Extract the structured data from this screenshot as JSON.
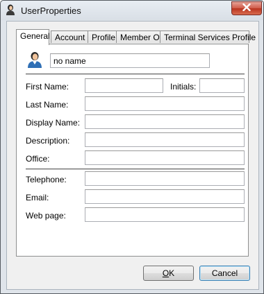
{
  "window": {
    "title": "UserProperties"
  },
  "icons": {
    "app": "user-icon",
    "close": "close-icon",
    "user": "user-icon"
  },
  "tabs": [
    {
      "label": "General",
      "active": true
    },
    {
      "label": "Account",
      "active": false
    },
    {
      "label": "Profile",
      "active": false
    },
    {
      "label": "Member Of",
      "active": false
    },
    {
      "label": "Terminal Services Profile",
      "active": false
    }
  ],
  "general": {
    "name_value": "no name",
    "first_name_label": "First Name:",
    "first_name_value": "",
    "initials_label": "Initials:",
    "initials_value": "",
    "last_name_label": "Last Name:",
    "last_name_value": "",
    "display_name_label": "Display Name:",
    "display_name_value": "",
    "description_label": "Description:",
    "description_value": "",
    "office_label": "Office:",
    "office_value": "",
    "telephone_label": "Telephone:",
    "telephone_value": "",
    "email_label": "Email:",
    "email_value": "",
    "webpage_label": "Web page:",
    "webpage_value": ""
  },
  "buttons": {
    "ok_mnemonic": "O",
    "ok_rest": "K",
    "cancel_label": "Cancel"
  },
  "colors": {
    "close_button": "#c74a34",
    "default_button_border": "#3c7fb1"
  }
}
